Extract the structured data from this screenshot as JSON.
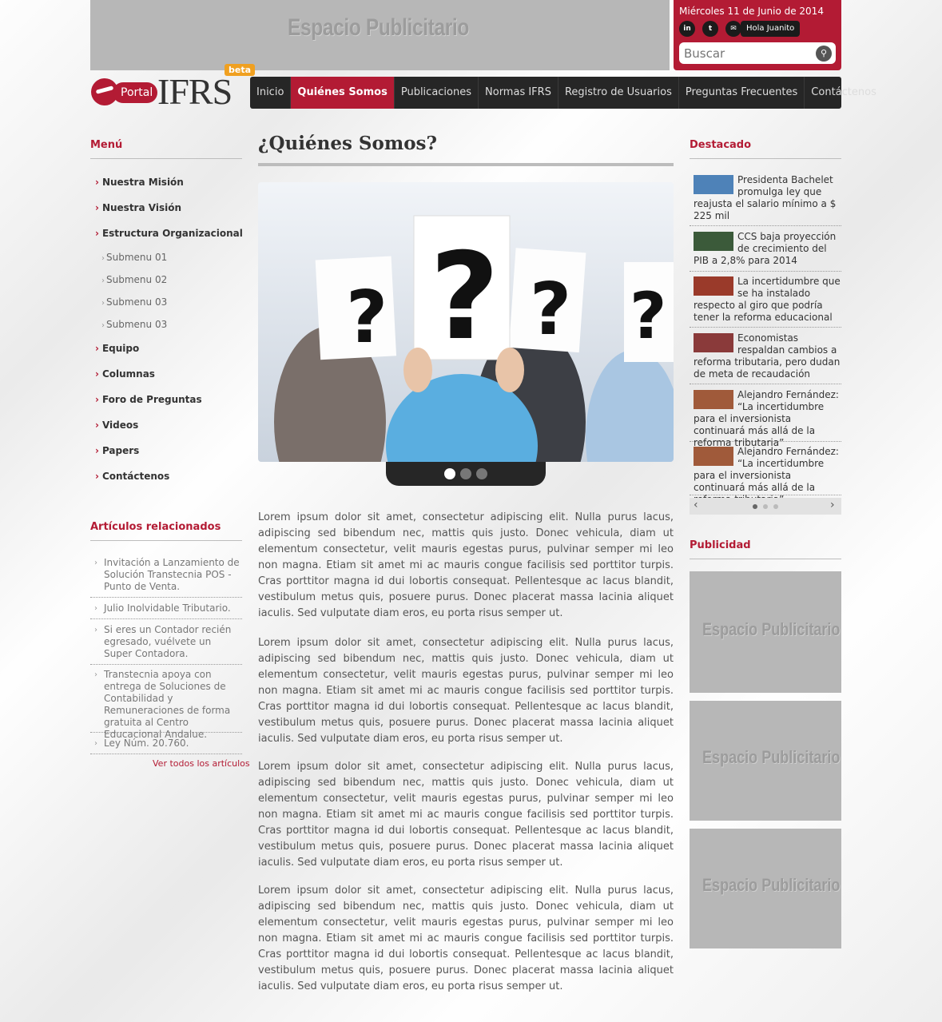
{
  "top_banner": {
    "ad_text": "Espacio Publicitario"
  },
  "top_box": {
    "date": "Miércoles 11 de Junio de 2014",
    "social": [
      "in",
      "t",
      "✉"
    ],
    "greeting": "Hola Juanito",
    "search_placeholder": "Buscar"
  },
  "logo": {
    "portal": "Portal",
    "name": "IFRS",
    "badge": "beta"
  },
  "nav": [
    "Inicio",
    "Quiénes Somos",
    "Publicaciones",
    "Normas IFRS",
    "Registro de Usuarios",
    "Preguntas Frecuentes",
    "Contáctenos"
  ],
  "left": {
    "menu_title": "Menú",
    "menu": [
      {
        "label": "Nuestra Misión"
      },
      {
        "label": "Nuestra Visión"
      },
      {
        "label": "Estructura Organizacional"
      },
      {
        "label": "Equipo"
      },
      {
        "label": "Columnas"
      },
      {
        "label": "Foro de Preguntas"
      },
      {
        "label": "Videos"
      },
      {
        "label": "Papers"
      },
      {
        "label": "Contáctenos"
      }
    ],
    "submenu": [
      "Submenu 01",
      "Submenu 02",
      "Submenu 03",
      "Submenu 03"
    ],
    "articles_title": "Artículos relacionados",
    "articles": [
      "Invitación a Lanzamiento de Solución Transtecnia POS - Punto de Venta.",
      "Julio Inolvidable Tributario.",
      "Si eres un Contador recién egresado, vuélvete un Super Contadora.",
      "Transtecnia apoya con entrega de Soluciones de Contabilidad y Remuneraciones de forma gratuita al Centro Educacional Andalue.",
      "Ley Núm. 20.760."
    ],
    "see_all": "Ver todos los artículos"
  },
  "main": {
    "title": "¿Quiénes Somos?",
    "paragraphs": [
      "Lorem ipsum dolor sit amet, consectetur adipiscing elit. Nulla purus lacus, adipiscing sed bibendum nec, mattis quis justo. Donec vehicula, diam ut elementum consectetur, velit mauris egestas purus, pulvinar semper mi leo non magna. Etiam sit amet mi ac mauris congue facilisis sed porttitor turpis. Cras porttitor magna id dui lobortis consequat. Pellentesque ac lacus blandit, vestibulum metus quis, posuere purus. Donec placerat massa lacinia aliquet iaculis. Sed vulputate diam eros, eu porta risus semper ut.",
      "Lorem ipsum dolor sit amet, consectetur adipiscing elit. Nulla purus lacus, adipiscing sed bibendum nec, mattis quis justo. Donec vehicula, diam ut elementum consectetur, velit mauris egestas purus, pulvinar semper mi leo non magna. Etiam sit amet mi ac mauris congue facilisis sed porttitor turpis. Cras porttitor magna id dui lobortis consequat. Pellentesque ac lacus blandit, vestibulum metus quis, posuere purus. Donec placerat massa lacinia aliquet iaculis. Sed vulputate diam eros, eu porta risus semper ut.",
      "Lorem ipsum dolor sit amet, consectetur adipiscing elit. Nulla purus lacus, adipiscing sed bibendum nec, mattis quis justo. Donec vehicula, diam ut elementum consectetur, velit mauris egestas purus, pulvinar semper mi leo non magna. Etiam sit amet mi ac mauris congue facilisis sed porttitor turpis. Cras porttitor magna id dui lobortis consequat. Pellentesque ac lacus blandit, vestibulum metus quis, posuere purus. Donec placerat massa lacinia aliquet iaculis. Sed vulputate diam eros, eu porta risus semper ut.",
      "Lorem ipsum dolor sit amet, consectetur adipiscing elit. Nulla purus lacus, adipiscing sed bibendum nec, mattis quis justo. Donec vehicula, diam ut elementum consectetur, velit mauris egestas purus, pulvinar semper mi leo non magna. Etiam sit amet mi ac mauris congue facilisis sed porttitor turpis. Cras porttitor magna id dui lobortis consequat. Pellentesque ac lacus blandit, vestibulum metus quis, posuere purus. Donec placerat massa lacinia aliquet iaculis. Sed vulputate diam eros, eu porta risus semper ut."
    ]
  },
  "right": {
    "featured_title": "Destacado",
    "news": [
      "Presidenta Bachelet promulga ley que reajusta el salario mínimo a $ 225 mil",
      "CCS baja proyección de crecimiento del PIB a 2,8% para 2014",
      "La incertidumbre que se ha instalado respecto al giro que podría tener la reforma educacional",
      "Economistas respaldan cambios a reforma tributaria, pero dudan de meta de recaudación",
      "Alejandro Fernández: “La incertidumbre para el inversionista continuará más allá de la reforma tributaria”",
      "Alejandro Fernández: “La incertidumbre para el inversionista continuará más allá de la reforma tributaria”"
    ],
    "ads_title": "Publicidad",
    "ads": [
      "Espacio Publicitario",
      "Espacio Publicitario",
      "Espacio Publicitario"
    ]
  },
  "colors": {
    "accent": "#b31b34",
    "nav_bg": "#262626",
    "ad_gray": "#b7b7b7"
  }
}
